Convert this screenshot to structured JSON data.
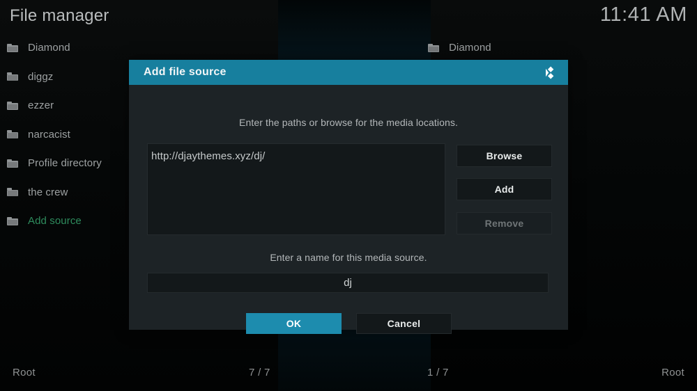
{
  "window": {
    "title": "File manager",
    "clock": "11:41 AM"
  },
  "colors": {
    "accent_teal": "#177f9e",
    "focus_teal": "#1d8cae",
    "add_source_green": "#2e8c5d",
    "dialog_bg": "#1d2326",
    "field_bg": "#13181a"
  },
  "left_pane": {
    "items": [
      {
        "label": "Diamond",
        "icon": "folder-icon",
        "accent": false
      },
      {
        "label": "diggz",
        "icon": "folder-icon",
        "accent": false
      },
      {
        "label": "ezzer",
        "icon": "folder-icon",
        "accent": false
      },
      {
        "label": "narcacist",
        "icon": "folder-icon",
        "accent": false
      },
      {
        "label": "Profile directory",
        "icon": "folder-icon",
        "accent": false
      },
      {
        "label": "the crew",
        "icon": "folder-icon",
        "accent": false
      },
      {
        "label": "Add source",
        "icon": "folder-icon",
        "accent": true
      }
    ]
  },
  "right_pane": {
    "items": [
      {
        "label": "Diamond",
        "icon": "folder-icon",
        "accent": false
      }
    ]
  },
  "statusbar": {
    "left_path": "Root",
    "left_count": "7 / 7",
    "right_count": "1 / 7",
    "right_path": "Root"
  },
  "dialog": {
    "title": "Add file source",
    "logo_icon": "kodi-logo-icon",
    "hint_paths": "Enter the paths or browse for the media locations.",
    "hint_name": "Enter a name for this media source.",
    "paths": [
      "http://djaythemes.xyz/dj/"
    ],
    "buttons": {
      "browse": "Browse",
      "add": "Add",
      "remove": "Remove",
      "ok": "OK",
      "cancel": "Cancel"
    },
    "name_value": "dj"
  }
}
